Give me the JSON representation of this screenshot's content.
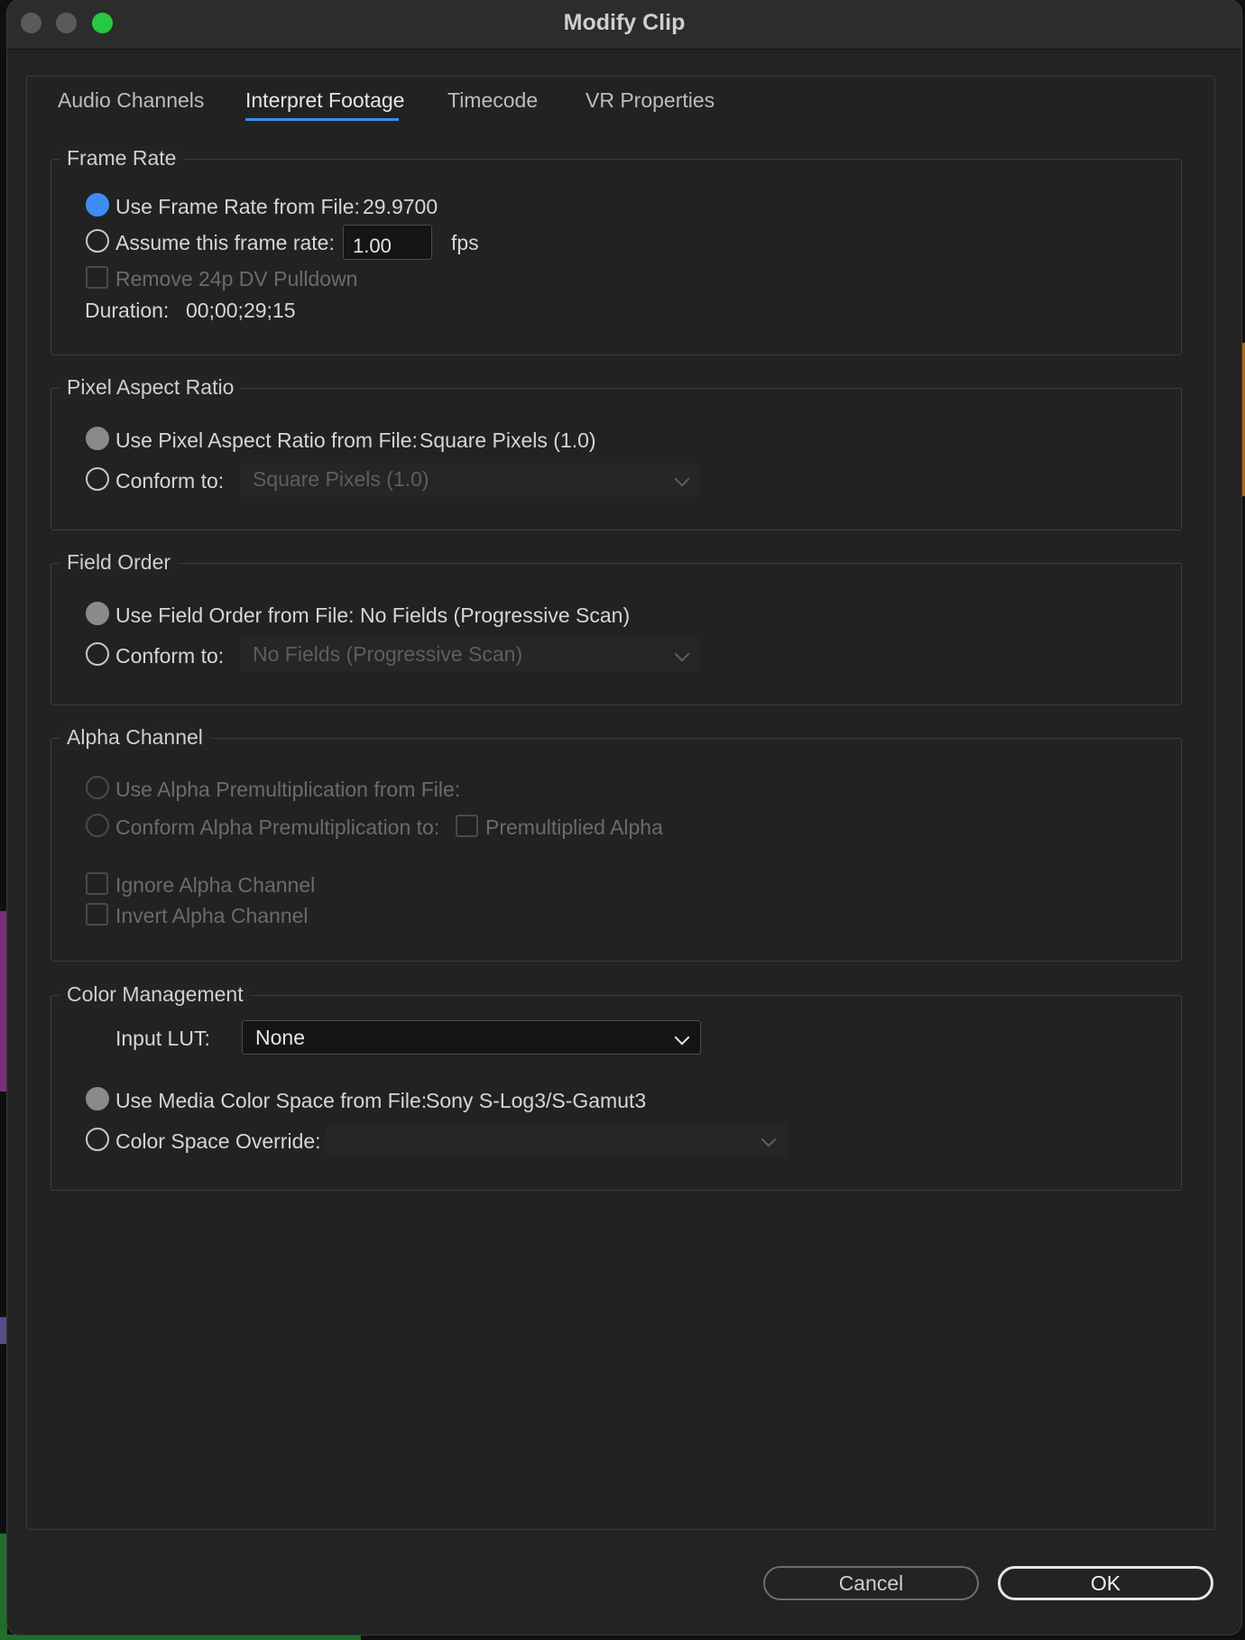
{
  "window": {
    "title": "Modify Clip"
  },
  "tabs": [
    {
      "label": "Audio Channels"
    },
    {
      "label": "Interpret Footage"
    },
    {
      "label": "Timecode"
    },
    {
      "label": "VR Properties"
    }
  ],
  "frame_rate": {
    "legend": "Frame Rate",
    "use_file_label": "Use Frame Rate from File:",
    "file_value": "29.9700",
    "assume_label": "Assume this frame rate:",
    "assume_value": "1.00",
    "assume_unit": "fps",
    "pulldown_label": "Remove 24p DV Pulldown",
    "duration_label": "Duration:",
    "duration_value": "00;00;29;15"
  },
  "pixel_aspect": {
    "legend": "Pixel Aspect Ratio",
    "use_file_label": "Use Pixel Aspect Ratio from File:",
    "file_value": "Square Pixels (1.0)",
    "conform_label": "Conform to:",
    "conform_value": "Square Pixels (1.0)"
  },
  "field_order": {
    "legend": "Field Order",
    "use_file_label": "Use Field Order from File:",
    "file_value": "No Fields (Progressive Scan)",
    "conform_label": "Conform to:",
    "conform_value": "No Fields (Progressive Scan)"
  },
  "alpha": {
    "legend": "Alpha Channel",
    "use_file_label": "Use Alpha Premultiplication from File:",
    "conform_label": "Conform Alpha Premultiplication to:",
    "premult_label": "Premultiplied Alpha",
    "ignore_label": "Ignore Alpha Channel",
    "invert_label": "Invert Alpha Channel"
  },
  "color": {
    "legend": "Color Management",
    "lut_label": "Input LUT:",
    "lut_value": "None",
    "use_file_label": "Use Media Color Space from File:",
    "file_value": "Sony S-Log3/S-Gamut3",
    "override_label": "Color Space Override:",
    "override_value": ""
  },
  "buttons": {
    "cancel": "Cancel",
    "ok": "OK"
  },
  "colors": {
    "accent": "#3d8df5",
    "window_bg": "#232323",
    "traffic_light_green": "#28c840"
  }
}
